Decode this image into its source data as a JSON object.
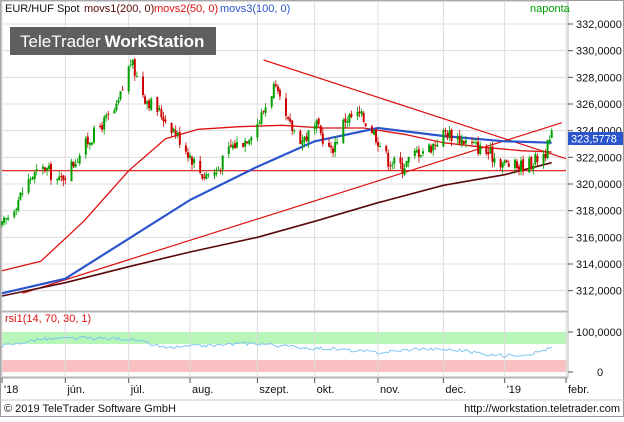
{
  "header": {
    "series_label": "EUR/HUF Spot",
    "ma_labels": [
      "movs1(200, 0)",
      "movs2(50, 0)",
      "movs3(100, 0)"
    ],
    "frequency": "naponta",
    "watermark_brand": "TeleTrader",
    "watermark_product": "WorkStation"
  },
  "footer": {
    "copyright": "© 2019 TeleTrader Software GmbH",
    "url": "http://workstation.teletrader.com"
  },
  "rsi": {
    "label": "rsi1(14, 70, 30, 1)",
    "upper_label": "100,0000",
    "lower_label": "0"
  },
  "last_price_label": "323,5778",
  "colors": {
    "candle_up": "#00a000",
    "candle_down": "#cc0000",
    "ma200": "#5a0a0a",
    "ma50": "#dd1111",
    "ma100": "#2b55cc",
    "trendline": "#dd1111",
    "rsi_line": "#7fc6f0",
    "rsi_overbought": "#b8f5b8",
    "rsi_oversold": "#f8c0c0",
    "price_tag": "#2b55cc",
    "background": "#ffffff",
    "grid": "#dcdcdc"
  },
  "chart_data": {
    "type": "candlestick",
    "title": "",
    "y_ticks": [
      "332,0000",
      "330,0000",
      "328,0000",
      "326,0000",
      "324,0000",
      "322,0000",
      "320,0000",
      "318,0000",
      "316,0000",
      "314,0000",
      "312,0000"
    ],
    "ylim": [
      311.3,
      332.3
    ],
    "x_tick_labels": [
      "'18",
      "jún.",
      "júl.",
      "aug.",
      "szept.",
      "okt.",
      "nov.",
      "dec.",
      "'19",
      "febr."
    ],
    "x_tick_dates": [
      "2018-05-01",
      "2018-06-01",
      "2018-07-02",
      "2018-08-01",
      "2018-09-03",
      "2018-10-01",
      "2018-11-01",
      "2018-12-03",
      "2019-01-02",
      "2019-02-01"
    ],
    "x_range": [
      "2018-05-01",
      "2019-02-01"
    ],
    "grid": true,
    "close_profile": {
      "dates": [
        "2018-05-01",
        "2018-05-08",
        "2018-05-15",
        "2018-05-22",
        "2018-05-29",
        "2018-06-05",
        "2018-06-12",
        "2018-06-19",
        "2018-06-26",
        "2018-07-03",
        "2018-07-10",
        "2018-07-17",
        "2018-07-24",
        "2018-07-31",
        "2018-08-07",
        "2018-08-14",
        "2018-08-21",
        "2018-08-28",
        "2018-09-04",
        "2018-09-11",
        "2018-09-18",
        "2018-09-25",
        "2018-10-02",
        "2018-10-09",
        "2018-10-16",
        "2018-10-23",
        "2018-10-30",
        "2018-11-06",
        "2018-11-13",
        "2018-11-20",
        "2018-11-27",
        "2018-12-04",
        "2018-12-11",
        "2018-12-18",
        "2018-12-25",
        "2019-01-01",
        "2019-01-08",
        "2019-01-15",
        "2019-01-22",
        "2019-01-25"
      ],
      "close": [
        316.8,
        318.6,
        320.5,
        321.2,
        320.2,
        321.6,
        323.2,
        324.5,
        325.6,
        329.2,
        326.5,
        325.4,
        324.1,
        322.4,
        320.7,
        320.9,
        322.8,
        323.3,
        324.8,
        327.3,
        324.5,
        323.3,
        324.3,
        322.4,
        324.9,
        325.2,
        323.9,
        321.8,
        321.3,
        322.4,
        322.8,
        323.9,
        323.4,
        322.9,
        322.3,
        321.6,
        321.3,
        321.6,
        322.4,
        323.6
      ]
    },
    "series": [
      {
        "name": "movs1(200, 0)",
        "type": "line",
        "x": [
          "2018-05-01",
          "2018-06-01",
          "2018-07-02",
          "2018-08-01",
          "2018-09-03",
          "2018-10-01",
          "2018-11-01",
          "2018-12-03",
          "2019-01-02",
          "2019-01-25"
        ],
        "y": [
          311.6,
          312.6,
          313.8,
          314.9,
          316.0,
          317.2,
          318.6,
          319.9,
          320.7,
          321.6
        ]
      },
      {
        "name": "movs2(50, 0)",
        "type": "line",
        "x": [
          "2018-05-01",
          "2018-05-20",
          "2018-06-10",
          "2018-07-02",
          "2018-07-20",
          "2018-08-05",
          "2018-08-25",
          "2018-09-15",
          "2018-10-05",
          "2018-10-25",
          "2018-11-15",
          "2018-12-03",
          "2018-12-20",
          "2019-01-10",
          "2019-01-25"
        ],
        "y": [
          313.5,
          314.2,
          317.2,
          321.0,
          323.4,
          324.1,
          324.3,
          324.4,
          324.2,
          324.2,
          323.7,
          323.1,
          322.8,
          322.5,
          322.4
        ]
      },
      {
        "name": "movs3(100, 0)",
        "type": "line",
        "x": [
          "2018-05-01",
          "2018-06-01",
          "2018-07-02",
          "2018-08-01",
          "2018-09-03",
          "2018-10-01",
          "2018-11-01",
          "2018-12-03",
          "2019-01-02",
          "2019-01-25"
        ],
        "y": [
          311.8,
          312.9,
          315.9,
          318.8,
          321.3,
          323.2,
          324.2,
          323.6,
          323.2,
          323.1
        ]
      }
    ],
    "trendlines": [
      {
        "x": [
          "2018-05-01",
          "2019-02-01"
        ],
        "y": [
          321.0,
          321.0
        ]
      },
      {
        "x": [
          "2018-05-11",
          "2019-01-30"
        ],
        "y": [
          311.8,
          324.6
        ]
      },
      {
        "x": [
          "2018-09-06",
          "2019-02-01"
        ],
        "y": [
          329.3,
          321.9
        ]
      }
    ],
    "rsi": {
      "ylim": [
        0,
        100
      ],
      "overbought": 70,
      "oversold": 30,
      "x": [
        "2018-05-01",
        "2018-05-20",
        "2018-06-10",
        "2018-07-02",
        "2018-07-20",
        "2018-08-10",
        "2018-09-01",
        "2018-09-20",
        "2018-10-10",
        "2018-11-01",
        "2018-11-20",
        "2018-12-10",
        "2019-01-01",
        "2019-01-15",
        "2019-01-25"
      ],
      "y": [
        65,
        82,
        84,
        83,
        60,
        66,
        72,
        63,
        58,
        48,
        58,
        55,
        40,
        46,
        60
      ]
    }
  }
}
